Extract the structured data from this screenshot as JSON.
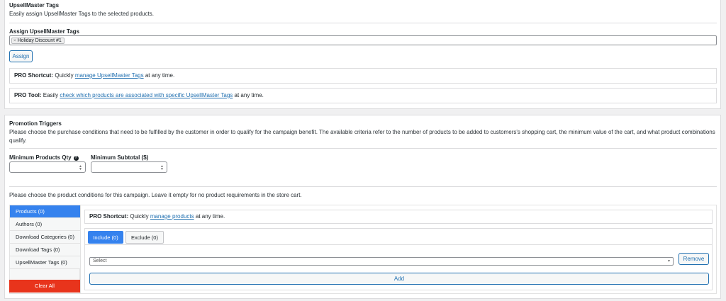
{
  "tags_section": {
    "title": "UpsellMaster Tags",
    "description": "Easily assign UpsellMaster Tags to the selected products.",
    "field_label": "Assign UpsellMaster Tags",
    "selected_tag": "Holiday Discount #1",
    "remove_symbol": "×",
    "assign_button": "Assign",
    "shortcut": {
      "label": "PRO Shortcut:",
      "before": "Quickly",
      "link": "manage UpsellMaster Tags",
      "after": "at any time."
    },
    "tool": {
      "label": "PRO Tool:",
      "before": "Easily",
      "link": "check which products are associated with specific UpsellMaster Tags",
      "after": "at any time."
    }
  },
  "promotion_section": {
    "title": "Promotion Triggers",
    "description": "Please choose the purchase conditions that need to be fulfilled by the customer in order to qualify for the campaign benefit. The available criteria refer to the number of products to be added to customers's shopping cart, the minimum value of the cart, and what product combinations qualify.",
    "min_qty_label": "Minimum Products Qty",
    "help_symbol": "?",
    "min_subtotal_label": "Minimum Subtotal ($)",
    "min_qty_value": "",
    "min_subtotal_value": "",
    "product_conditions_text": "Please choose the product conditions for this campaign. Leave it empty for no product requirements in the store cart.",
    "sidebar": [
      {
        "label": "Products (0)",
        "active": true
      },
      {
        "label": "Authors (0)",
        "active": false
      },
      {
        "label": "Download Categories (0)",
        "active": false
      },
      {
        "label": "Download Tags (0)",
        "active": false
      },
      {
        "label": "UpsellMaster Tags (0)",
        "active": false
      }
    ],
    "clear_all": "Clear All",
    "shortcut": {
      "label": "PRO Shortcut:",
      "before": "Quickly",
      "link": "manage products",
      "after": "at any time."
    },
    "tabs": [
      {
        "label": "Include (0)",
        "active": true
      },
      {
        "label": "Exclude (0)",
        "active": false
      }
    ],
    "select_placeholder": "Select",
    "remove_button": "Remove",
    "add_button": "Add"
  },
  "colors": {
    "accent": "#2271b1",
    "active_blue": "#3582ee",
    "danger": "#e8341c",
    "page_bg": "#f0f0f1"
  }
}
